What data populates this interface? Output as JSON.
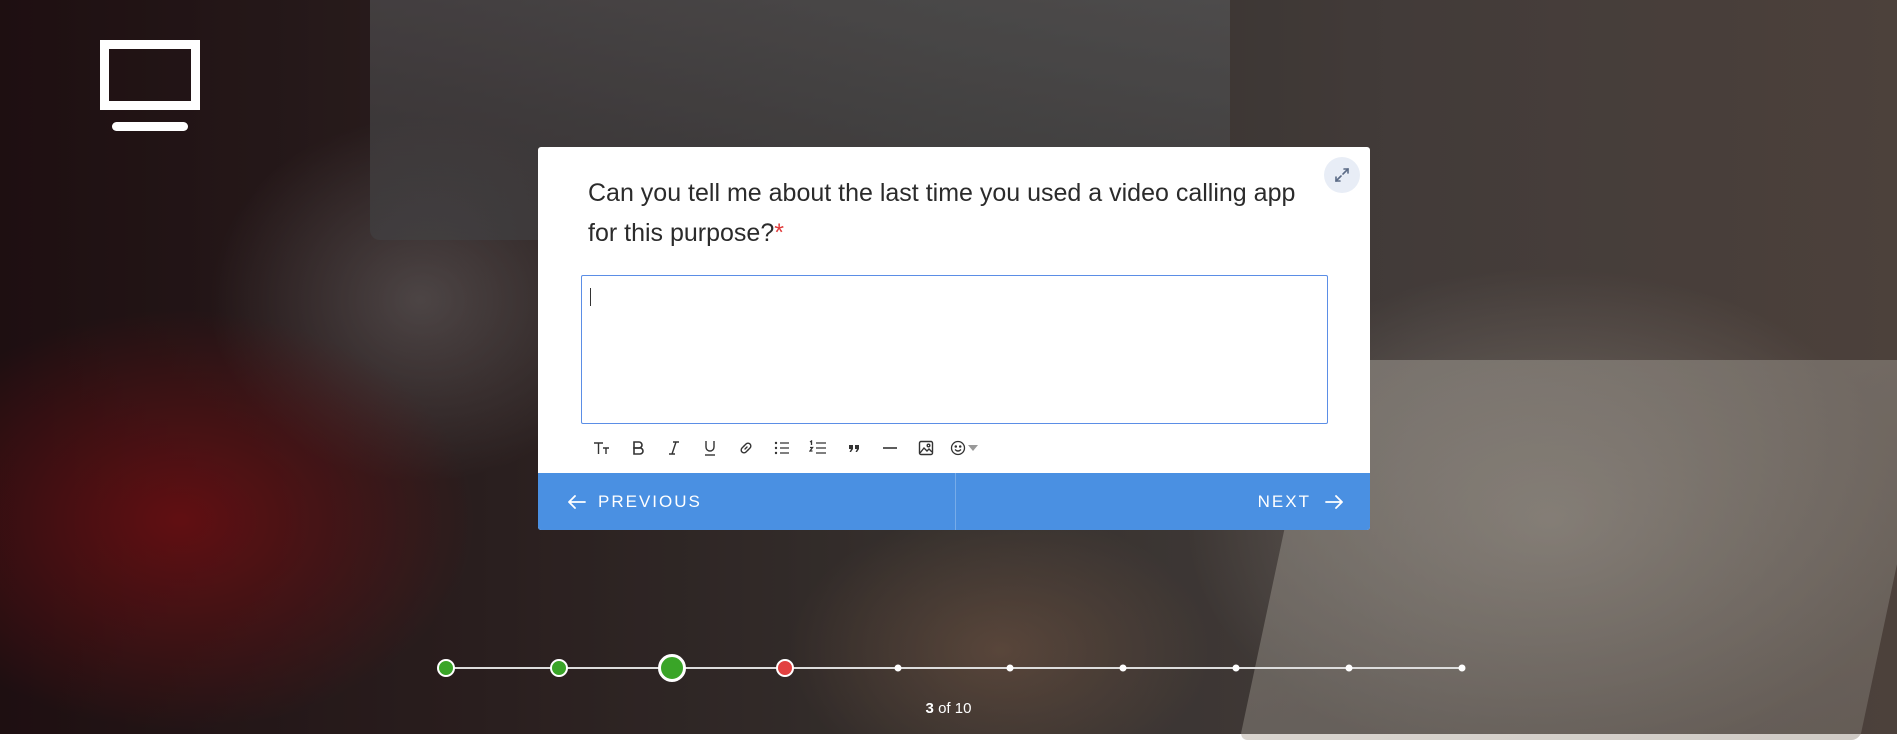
{
  "form": {
    "question": "Can you tell me about the last time you used a video calling app for this purpose?",
    "required_mark": "*",
    "answer_value": ""
  },
  "toolbar": {
    "icons": [
      "text-size-icon",
      "bold-icon",
      "italic-icon",
      "underline-icon",
      "link-icon",
      "bulleted-list-icon",
      "numbered-list-icon",
      "quote-icon",
      "horizontal-rule-icon",
      "image-icon",
      "emoji-icon"
    ]
  },
  "nav": {
    "previous_label": "PREVIOUS",
    "next_label": "NEXT"
  },
  "progress": {
    "current": "3",
    "of_text": "of",
    "total": "10",
    "steps": [
      "done",
      "done",
      "current",
      "error",
      "todo",
      "todo",
      "todo",
      "todo",
      "todo",
      "todo"
    ]
  },
  "colors": {
    "accent": "#4a90e2",
    "success": "#3aa528",
    "error": "#e24141",
    "required": "#e03c3c"
  }
}
